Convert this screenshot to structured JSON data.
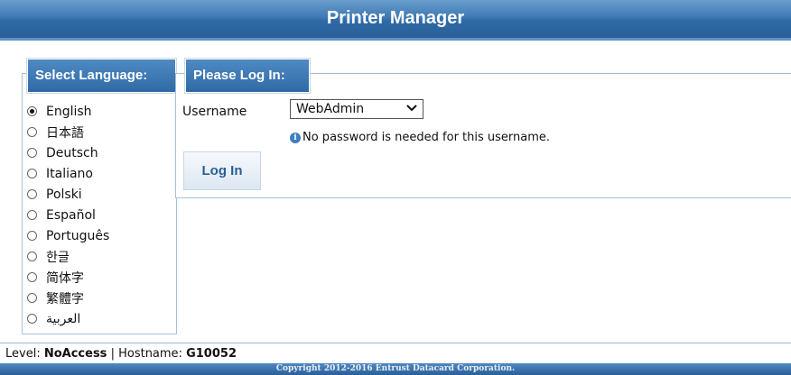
{
  "header": {
    "title": "Printer Manager"
  },
  "language_panel": {
    "legend": "Select Language:",
    "selected": "English",
    "languages": [
      "English",
      "日本語",
      "Deutsch",
      "Italiano",
      "Polski",
      "Español",
      "Português",
      "한글",
      "简体字",
      "繁體字",
      "العربية"
    ]
  },
  "login_panel": {
    "legend": "Please Log In:",
    "username_label": "Username",
    "username_value": "WebAdmin",
    "info_text": "No password is needed for this username.",
    "login_button": "Log In"
  },
  "status": {
    "level_label": "Level:",
    "level_value": "NoAccess",
    "separator": "|",
    "hostname_label": "Hostname:",
    "hostname_value": "G10052"
  },
  "footer": {
    "copyright": "Copyright 2012-2016 Entrust Datacard Corporation."
  },
  "colors": {
    "header_blue": "#3f79b3",
    "border": "#a6c0da"
  },
  "icons": {
    "info": "info-icon",
    "dropdown": "chevron-down-icon"
  }
}
